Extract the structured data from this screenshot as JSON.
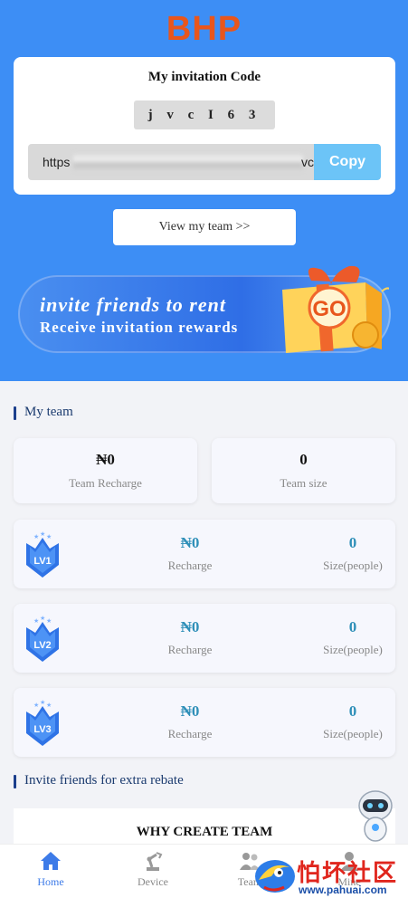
{
  "header": {
    "logo": "BHP"
  },
  "invite": {
    "title": "My invitation Code",
    "code": "j v c I 6 3",
    "link_prefix": "https",
    "link_suffix": "vc",
    "copy_label": "Copy"
  },
  "view_team_label": "View my team >>",
  "banner": {
    "line1": "invite friends to rent",
    "line2": "Receive invitation rewards",
    "go_label": "GO"
  },
  "my_team": {
    "title": "My team",
    "recharge_value": "₦0",
    "recharge_label": "Team Recharge",
    "size_value": "0",
    "size_label": "Team size"
  },
  "levels": [
    {
      "badge": "LV1",
      "recharge_value": "₦0",
      "recharge_label": "Recharge",
      "size_value": "0",
      "size_label": "Size(people)"
    },
    {
      "badge": "LV2",
      "recharge_value": "₦0",
      "recharge_label": "Recharge",
      "size_value": "0",
      "size_label": "Size(people)"
    },
    {
      "badge": "LV3",
      "recharge_value": "₦0",
      "recharge_label": "Recharge",
      "size_value": "0",
      "size_label": "Size(people)"
    }
  ],
  "rebate": {
    "title": "Invite friends for extra rebate"
  },
  "why": {
    "title": "WHY CREATE TEAM"
  },
  "tabs": [
    {
      "label": "Home",
      "icon": "home-icon",
      "active": true
    },
    {
      "label": "Device",
      "icon": "robot-arm-icon",
      "active": false
    },
    {
      "label": "Team",
      "icon": "team-icon",
      "active": false
    },
    {
      "label": "Mine",
      "icon": "user-icon",
      "active": false
    }
  ],
  "watermark": {
    "text": "怕坏社区",
    "url": "www.pahuai.com"
  },
  "colors": {
    "primary": "#3d8ef5",
    "logo": "#e8561c",
    "copy": "#6cc4f7",
    "level_value": "#2e8fb8",
    "tab_active": "#3d7be8"
  }
}
